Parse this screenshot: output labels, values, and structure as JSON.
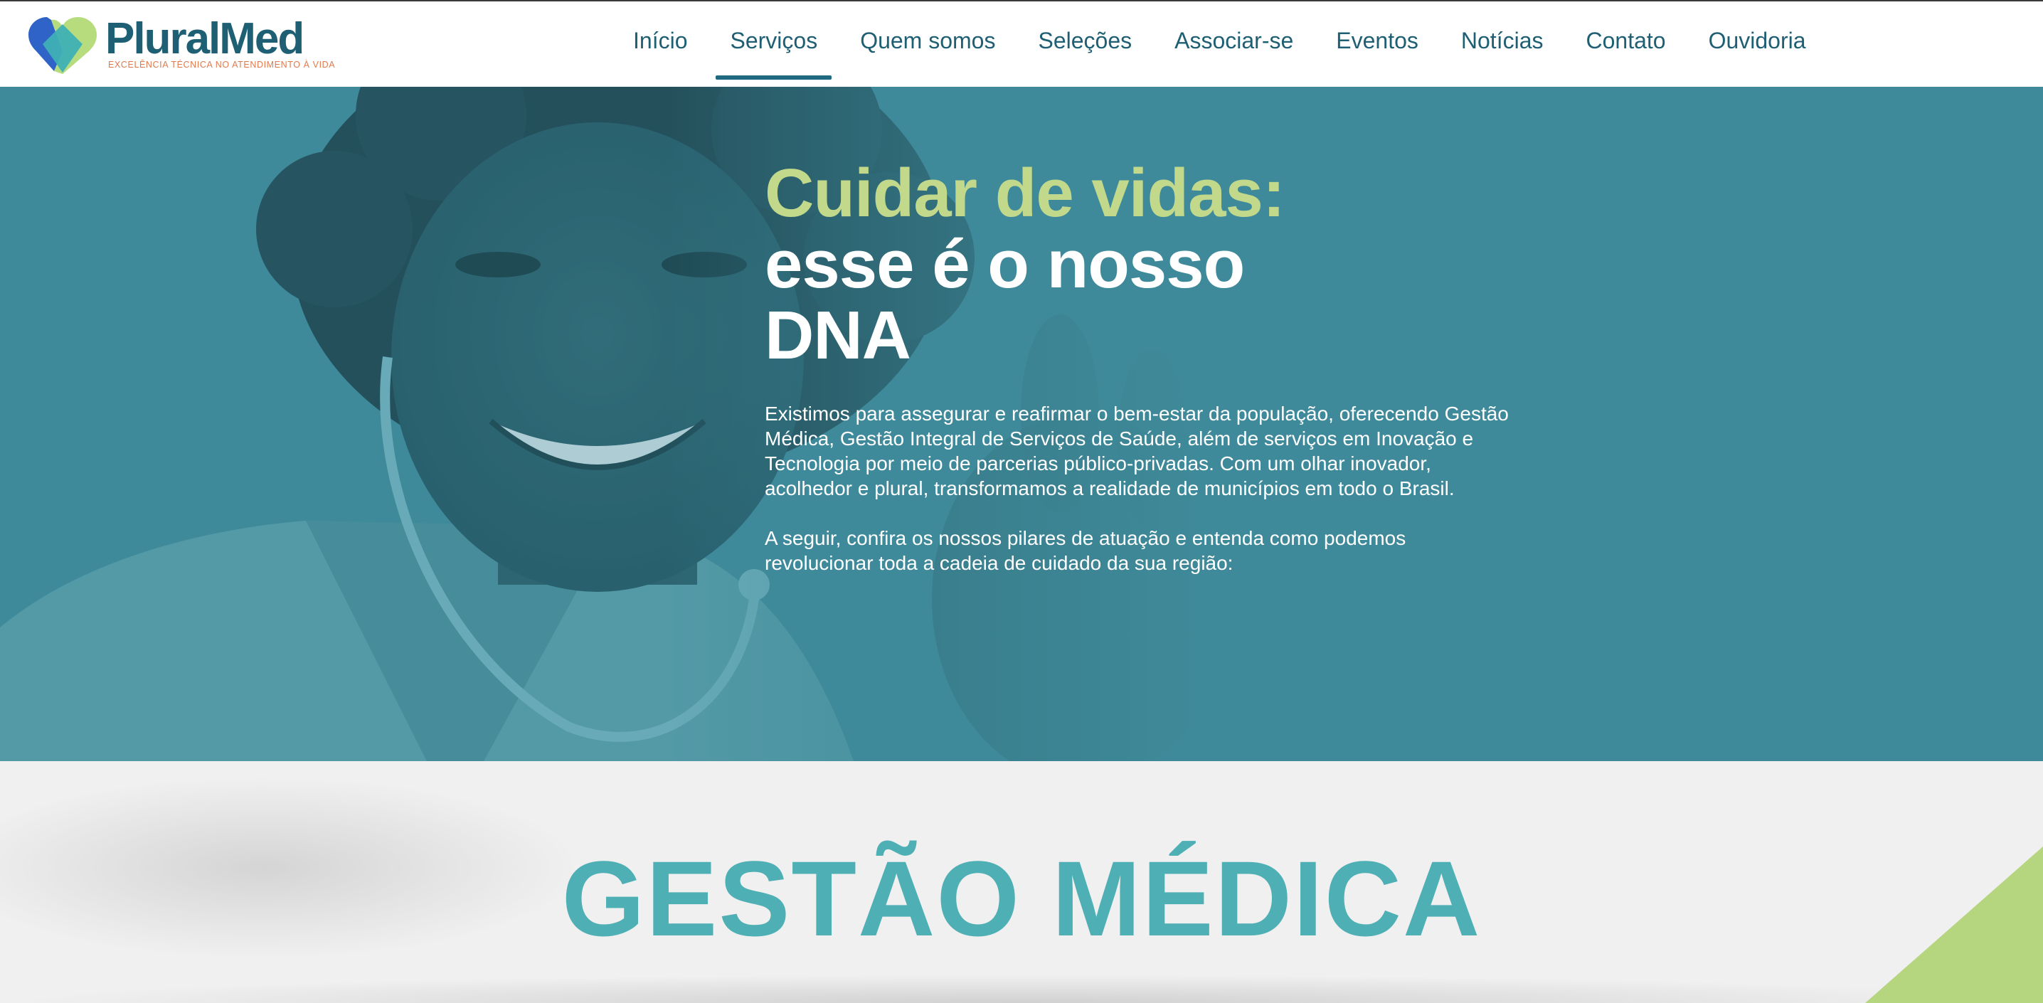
{
  "brand": {
    "name": "PluralMed",
    "tagline": "EXCELÊNCIA TÉCNICA NO ATENDIMENTO À VIDA",
    "colors": {
      "primary": "#1f5f73",
      "accent_green": "#c2d98b",
      "teal": "#3f8a9a",
      "tagline_orange": "#e07a4d",
      "section_title": "#4eafb5"
    }
  },
  "nav": {
    "items": [
      {
        "label": "Início",
        "active": false
      },
      {
        "label": "Serviços",
        "active": true
      },
      {
        "label": "Quem somos",
        "active": false
      },
      {
        "label": "Seleções",
        "active": false
      },
      {
        "label": "Associar-se",
        "active": false
      },
      {
        "label": "Eventos",
        "active": false
      },
      {
        "label": "Notícias",
        "active": false
      },
      {
        "label": "Contato",
        "active": false
      },
      {
        "label": "Ouvidoria",
        "active": false
      }
    ]
  },
  "hero": {
    "title_line1": "Cuidar de vidas:",
    "title_line2": "esse é o nosso",
    "title_line3": "DNA",
    "paragraph1": "Existimos para assegurar e reafirmar o bem-estar da população, oferecendo Gestão Médica, Gestão Integral de Serviços de Saúde, além de serviços em Inovação e Tecnologia por meio de parcerias público-privadas. Com um olhar inovador, acolhedor e plural, transformamos a realidade de municípios em todo o Brasil.",
    "paragraph2": "A seguir, confira os nossos pilares de atuação e entenda como podemos revolucionar toda a cadeia de cuidado da sua região:"
  },
  "section": {
    "title": "GESTÃO MÉDICA"
  }
}
